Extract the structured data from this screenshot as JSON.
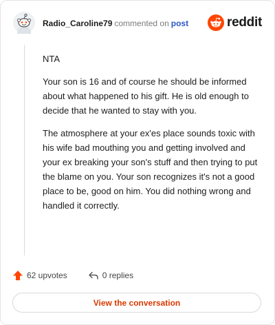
{
  "comment": {
    "username": "Radio_Caroline79",
    "commented_on": "commented on",
    "post_link": "post",
    "paragraphs": [
      "NTA",
      "Your son is 16 and of course he should be informed about what happened to his gift. He is old enough to decide that he wanted to stay with you.",
      "The atmosphere at your ex'es place sounds toxic with his wife bad mouthing you and getting involved and your ex breaking your son's stuff and then trying to put the blame on you. Your son recognizes it's not a good place to be, good on him. You did nothing wrong and handled it correctly."
    ]
  },
  "brand": {
    "name": "reddit",
    "icon": "reddit-snoo-icon",
    "color": "#ff4500"
  },
  "actions": {
    "upvotes": "62 upvotes",
    "replies": "0 replies",
    "upvote_icon": "upvote-arrow-icon",
    "reply_icon": "reply-arrow-icon",
    "upvote_color": "#ff4500"
  },
  "view_button": "View the conversation"
}
